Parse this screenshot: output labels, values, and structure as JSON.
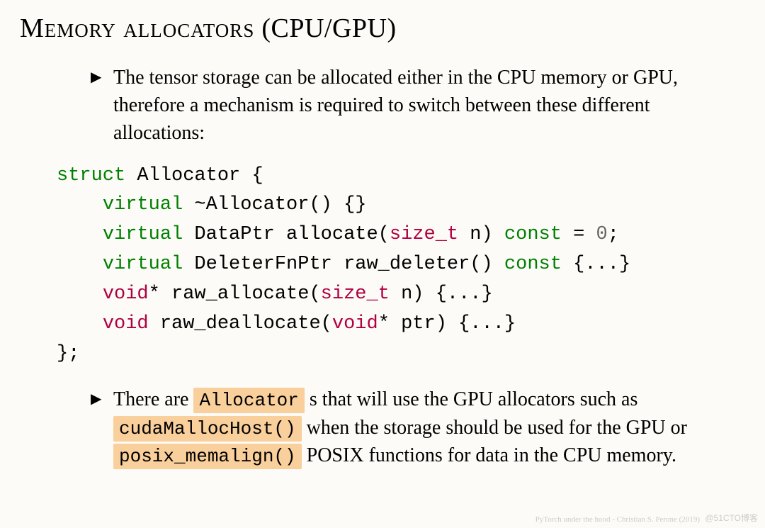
{
  "title": {
    "caps": "Memory allocators",
    "rest": " (CPU/GPU)"
  },
  "bullets": {
    "first": "The tensor storage can be allocated either in the CPU memory or GPU, therefore a mechanism is required to switch between these different allocations:",
    "second": {
      "t1": "There are ",
      "hl1": "Allocator",
      "t2": " s that will use the GPU allocators such as ",
      "hl2": "cudaMallocHost()",
      "t3": " when the storage should be used for the GPU or ",
      "hl3": "posix_memalign()",
      "t4": " POSIX functions for data in the CPU memory."
    }
  },
  "code": {
    "l1": {
      "kw": "struct",
      "rest": " Allocator {"
    },
    "l2": {
      "kw": "virtual",
      "rest": " ~Allocator() {}"
    },
    "l3": {
      "kw1": "virtual",
      "mid1": " DataPtr allocate(",
      "ty": "size_t",
      "mid2": " n) ",
      "kw2": "const",
      "eq": " = ",
      "num": "0",
      "end": ";"
    },
    "l4": {
      "kw1": "virtual",
      "mid": " DeleterFnPtr raw_deleter() ",
      "kw2": "const",
      "end": " {...}"
    },
    "l5": {
      "ty": "void",
      "mid1": "* raw_allocate(",
      "ty2": "size_t",
      "mid2": " n) {...}"
    },
    "l6": {
      "ty": "void",
      "mid1": " raw_deallocate(",
      "ty2": "void",
      "mid2": "* ptr) {...}"
    },
    "l7": "};"
  },
  "footer": {
    "credit": "PyTorch under the hood - Christian S. Perone (2019)",
    "watermark": "@51CTO博客"
  }
}
